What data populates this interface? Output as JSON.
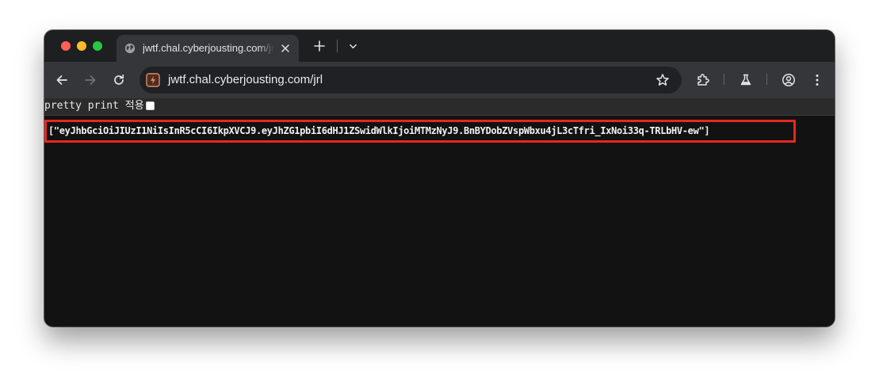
{
  "tab": {
    "title": "jwtf.chal.cyberjousting.com/jrl",
    "icon": "globe-icon"
  },
  "omnibox": {
    "url": "jwtf.chal.cyberjousting.com/jrl",
    "site_icon": "site-favicon-icon"
  },
  "page": {
    "pretty_print_label": "pretty print 적용",
    "pretty_print_checked": false,
    "json_content": "[\"eyJhbGciOiJIUzI1NiIsInR5cCI6IkpXVCJ9.eyJhZG1pbiI6dHJ1ZSwidWlkIjoiMTMzNyJ9.BnBYDobZVspWbxu4jL3cTfri_IxNoi33q-TRLbHV-ew\"]"
  },
  "colors": {
    "highlight_border": "#e8281c",
    "page_background": "#121212",
    "toolbar_background": "#35363a"
  }
}
